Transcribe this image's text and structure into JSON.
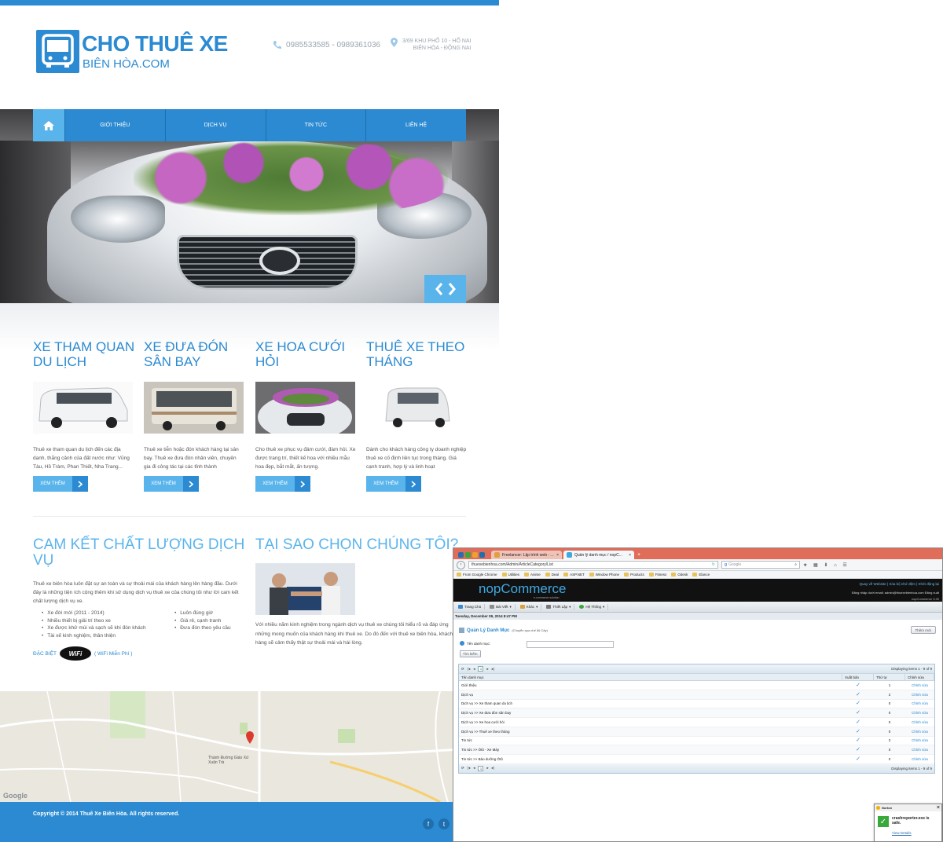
{
  "site": {
    "logo_title": "CHO THUÊ XE",
    "logo_sub": "BIÊN HÒA.COM",
    "phone": "0985533585 - 0989361036",
    "address_line1": "3/69 KHU PHỐ 10 - HỐ NAI",
    "address_line2": "BIÊN HÒA - ĐỒNG NAI",
    "nav": [
      "GIỚI THIỆU",
      "DỊCH VỤ",
      "TIN TỨC",
      "LIÊN HỆ"
    ],
    "services": [
      {
        "title": "XE THAM QUAN DU LỊCH",
        "text": "Thuê xe tham quan du lịch đến các địa danh, thắng cảnh của đất nước như: Vũng Tàu, Hồ Tràm, Phan Thiết, Nha Trang...",
        "more": "XEM THÊM"
      },
      {
        "title": "XE ĐƯA ĐÓN SÂN BAY",
        "text": "Thuê xe tiễn hoặc đón khách hàng tại sân bay. Thuê xe đưa đón nhân viên, chuyên gia đi công tác tại các tỉnh thành",
        "more": "XEM THÊM"
      },
      {
        "title": "XE HOA CƯỚI HỎI",
        "text": "Cho thuê xe phục vụ đám cưới, đám hỏi. Xe được trang trí, thiết kế hoa với nhiều mẫu hoa đẹp, bắt mắt, ấn tượng.",
        "more": "XEM THÊM"
      },
      {
        "title": "THUÊ XE THEO THÁNG",
        "text": "Dành cho khách hàng công ty doanh nghiệp thuê xe cố định liên tục trong tháng. Giá cạnh tranh, hợp lý và linh hoạt",
        "more": "XEM THÊM"
      }
    ],
    "commit_title": "CAM KẾT CHẤT LƯỢNG DỊCH VỤ",
    "commit_text": "Thuê xe biên hòa luôn đặt sự an toàn và sự thoải mái của khách hàng lên hàng đầu. Dưới đây là những tiện ích cộng thêm khi sử dụng dịch vụ thuê xe của chúng tôi như lời cam kết chất lượng dịch vụ xe.",
    "commit_list1": [
      "Xe đời mới (2011 - 2014)",
      "Nhiều thiết bị giải trí theo xe",
      "Xe được khử mùi và sạch sẽ khi đón khách",
      "Tài xế kinh nghiệm, thân thiện"
    ],
    "commit_list2": [
      "Luôn đúng giờ",
      "Giá rẻ, cạnh tranh",
      "Đưa đón theo yêu cầu"
    ],
    "special_label": "ĐẶC BIỆT",
    "wifi_badge": "WiFi",
    "wifi_text": "( WiFi Miễn Phí )",
    "why_title": "TẠI SAO CHỌN CHÚNG TÔI?",
    "why_text": "Với nhiều năm kinh nghiệm trong ngành dịch vụ thuê xe chúng tôi hiểu rõ và đáp ứng những mong muốn của khách hàng khi thuê xe. Do đó đến với thuê xe biên hòa, khách hàng sẽ cảm thấy thật sự thoải mái và hài lòng.",
    "map_labels": [
      "Thánh Đường Giáo Xứ Xuân Trà",
      "Google"
    ],
    "copyright": "Copyright © 2014 Thuê Xe Biên Hòa. All rights reserved."
  },
  "browser": {
    "tabs": [
      "Freelancer: Lập trình web - ...",
      "Quản lý danh mục / nopC..."
    ],
    "url": "thuexebienhoa.com/Admin/ArticleCategory/List",
    "search_placeholder": "Google",
    "bookmarks": [
      "From Google Chrome",
      "Utilities",
      "Anime",
      "Deal",
      "ASP.NET",
      "Window Phone",
      "Products",
      "Fitness",
      "Odesk",
      "Elance"
    ],
    "nop_logo": "nopCommerce",
    "nop_sub": "e-commerce solution",
    "nop_links": "Quay về Website | Xóa bộ nhớ đệm | Khởi động lại",
    "nop_user": "Đăng nhập dưới email: admin@thuexebienhoa.com  Đăng xuất",
    "nop_version": "nopCommerce 3.30",
    "menu": [
      "Trang Chủ",
      "Bài Viết",
      "Khác",
      "Thiết Lập",
      "Hệ Thống"
    ],
    "date": "Tuesday, December 09, 2014 8:47 PM",
    "page_title": "Quản Lý Danh Mục",
    "page_subtitle": "(Chuyển qua chế độ Cây)",
    "add_button": "Thêm mới",
    "search_label": "Tên danh mục:",
    "search_button": "Tìm kiếm",
    "pager_page": "1",
    "pager_info": "Displaying items 1 - 9 of 9",
    "columns": [
      "Tên danh mục",
      "Xuất bản",
      "Thứ tự",
      "Chỉnh sửa"
    ],
    "rows": [
      {
        "name": "Giới thiệu",
        "order": "1",
        "edit": "Chỉnh sửa"
      },
      {
        "name": "Dịch vụ",
        "order": "2",
        "edit": "Chỉnh sửa"
      },
      {
        "name": "Dịch vụ >> Xe tham quan du lịch",
        "order": "0",
        "edit": "Chỉnh sửa"
      },
      {
        "name": "Dịch vụ >> Xe đưa đón sân bay",
        "order": "0",
        "edit": "Chỉnh sửa"
      },
      {
        "name": "Dịch vụ >> Xe hoa cưới hỏi",
        "order": "0",
        "edit": "Chỉnh sửa"
      },
      {
        "name": "Dịch vụ >> Thuê xe theo tháng",
        "order": "0",
        "edit": "Chỉnh sửa"
      },
      {
        "name": "Tin tức",
        "order": "3",
        "edit": "Chỉnh sửa"
      },
      {
        "name": "Tin tức >> Ôtô - Xe Máy",
        "order": "0",
        "edit": "Chỉnh sửa"
      },
      {
        "name": "Tin tức >> Bảo dưỡng Ôtô",
        "order": "0",
        "edit": "Chỉnh sửa"
      }
    ]
  },
  "norton": {
    "brand": "Norton",
    "message": "crashreporter.exe is safe.",
    "link": "View Details",
    "close": "×"
  }
}
